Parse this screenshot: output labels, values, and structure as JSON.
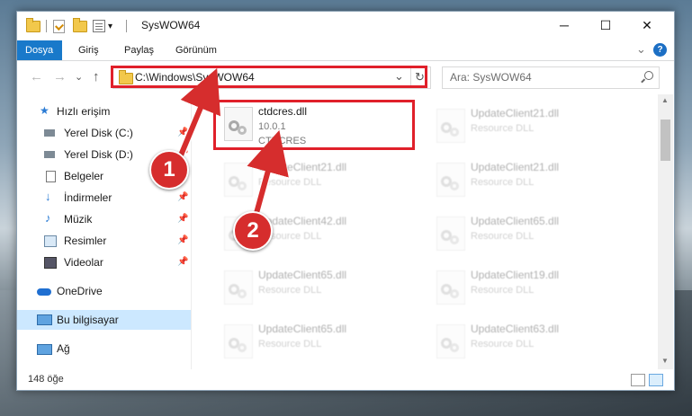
{
  "window": {
    "title": "SysWOW64"
  },
  "titlebar": {
    "minimize": "─",
    "maximize": "☐",
    "close": "✕"
  },
  "ribbon": {
    "tabs": [
      "Dosya",
      "Giriş",
      "Paylaş",
      "Görünüm"
    ],
    "expand": "⌄",
    "help": "?"
  },
  "nav": {
    "back": "←",
    "forward": "→",
    "recent": "⌄",
    "up": "↑",
    "address": "C:\\Windows\\SysWOW64",
    "address_dropdown": "⌄",
    "refresh": "↻",
    "search_placeholder": "Ara: SysWOW64"
  },
  "sidebar": {
    "items": [
      {
        "label": "Hızlı erişim",
        "icon": "star-icon",
        "pinned": false
      },
      {
        "label": "Yerel Disk (C:)",
        "icon": "drive-icon",
        "pinned": true
      },
      {
        "label": "Yerel Disk (D:)",
        "icon": "drive-icon",
        "pinned": true
      },
      {
        "label": "Belgeler",
        "icon": "documents-icon",
        "pinned": true
      },
      {
        "label": "İndirmeler",
        "icon": "download-icon",
        "pinned": true
      },
      {
        "label": "Müzik",
        "icon": "music-icon",
        "pinned": true
      },
      {
        "label": "Resimler",
        "icon": "pictures-icon",
        "pinned": true
      },
      {
        "label": "Videolar",
        "icon": "videos-icon",
        "pinned": true
      },
      {
        "label": "OneDrive",
        "icon": "cloud-icon",
        "pinned": false
      },
      {
        "label": "Bu bilgisayar",
        "icon": "computer-icon",
        "pinned": false,
        "selected": true
      },
      {
        "label": "Ağ",
        "icon": "network-icon",
        "pinned": false
      }
    ],
    "pin_glyph": "📌"
  },
  "files": {
    "highlighted": {
      "name": "ctdcres.dll",
      "version": "10.0.1",
      "description": "CTDCRES"
    },
    "background": [
      {
        "name": "UpdateClient21.dll",
        "type": "Resource DLL"
      },
      {
        "name": "UpdateClient21.dll",
        "type": "Resource DLL"
      },
      {
        "name": "UpdateClient21.dll",
        "type": "Resource DLL"
      },
      {
        "name": "UpdateClient42.dll",
        "type": "Resource DLL"
      },
      {
        "name": "UpdateClient65.dll",
        "type": "Resource DLL"
      },
      {
        "name": "UpdateClient65.dll",
        "type": "Resource DLL"
      },
      {
        "name": "UpdateClient19.dll",
        "type": "Resource DLL"
      },
      {
        "name": "UpdateClient65.dll",
        "type": "Resource DLL"
      },
      {
        "name": "UpdateClient63.dll",
        "type": "Resource DLL"
      }
    ]
  },
  "status": {
    "item_count": "148 öğe"
  },
  "annotations": {
    "step1": "1",
    "step2": "2",
    "color": "#e0202a"
  }
}
